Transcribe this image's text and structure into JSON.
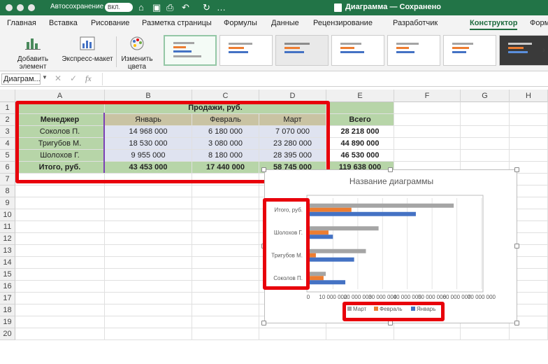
{
  "app": {
    "autosave_label": "Автосохранение",
    "autosave_state": "ВКЛ.",
    "doc_title": "Диаграмма — Сохранено"
  },
  "tabs": [
    "Главная",
    "Вставка",
    "Рисование",
    "Разметка страницы",
    "Формулы",
    "Данные",
    "Рецензирование",
    "Разработчик",
    "Конструктор",
    "Форм"
  ],
  "ribbon": {
    "add_element": "Добавить элемент диаграммы",
    "express_layout": "Экспресс-макет",
    "change_colors": "Изменить цвета"
  },
  "formula": {
    "namebox": "Диаграм...",
    "fx": "fx"
  },
  "columns": [
    "A",
    "B",
    "C",
    "D",
    "E",
    "F",
    "G",
    "H"
  ],
  "rows": [
    "1",
    "2",
    "3",
    "4",
    "5",
    "6",
    "7",
    "8",
    "9",
    "10",
    "11",
    "12",
    "13",
    "14",
    "15",
    "16",
    "17",
    "18",
    "19",
    "20"
  ],
  "table": {
    "title": "Продажи, руб.",
    "headers": [
      "Менеджер",
      "Январь",
      "Февраль",
      "Март",
      "Всего"
    ],
    "rows": [
      [
        "Соколов П.",
        "14 968 000",
        "6 180 000",
        "7 070 000",
        "28 218 000"
      ],
      [
        "Тригубов М.",
        "18 530 000",
        "3 080 000",
        "23 280 000",
        "44 890 000"
      ],
      [
        "Шолохов Г.",
        "9 955 000",
        "8 180 000",
        "28 395 000",
        "46 530 000"
      ],
      [
        "Итого, руб.",
        "43 453 000",
        "17 440 000",
        "58 745 000",
        "119 638 000"
      ]
    ]
  },
  "colors": {
    "excel_green": "#227447",
    "accent_red": "#e8000b",
    "jan": "#4472c4",
    "feb": "#ed7d31",
    "mar": "#a5a5a5"
  },
  "chart_data": {
    "type": "bar",
    "title": "Название диаграммы",
    "categories": [
      "Соколов П.",
      "Тригубов М.",
      "Шолохов Г.",
      "Итого, руб."
    ],
    "series": [
      {
        "name": "Январь",
        "values": [
          14968000,
          18530000,
          9955000,
          43453000
        ]
      },
      {
        "name": "Февраль",
        "values": [
          6180000,
          3080000,
          8180000,
          17440000
        ]
      },
      {
        "name": "Март",
        "values": [
          7070000,
          23280000,
          28395000,
          58745000
        ]
      }
    ],
    "xlim": [
      0,
      70000000
    ],
    "x_ticks": [
      "0",
      "10 000 000",
      "20 000 000",
      "30 000 000",
      "40 000 000",
      "50 000 000",
      "60 000 000",
      "70 000 000"
    ],
    "legend": [
      "Март",
      "Февраль",
      "Январь"
    ],
    "legend_position": "bottom"
  }
}
